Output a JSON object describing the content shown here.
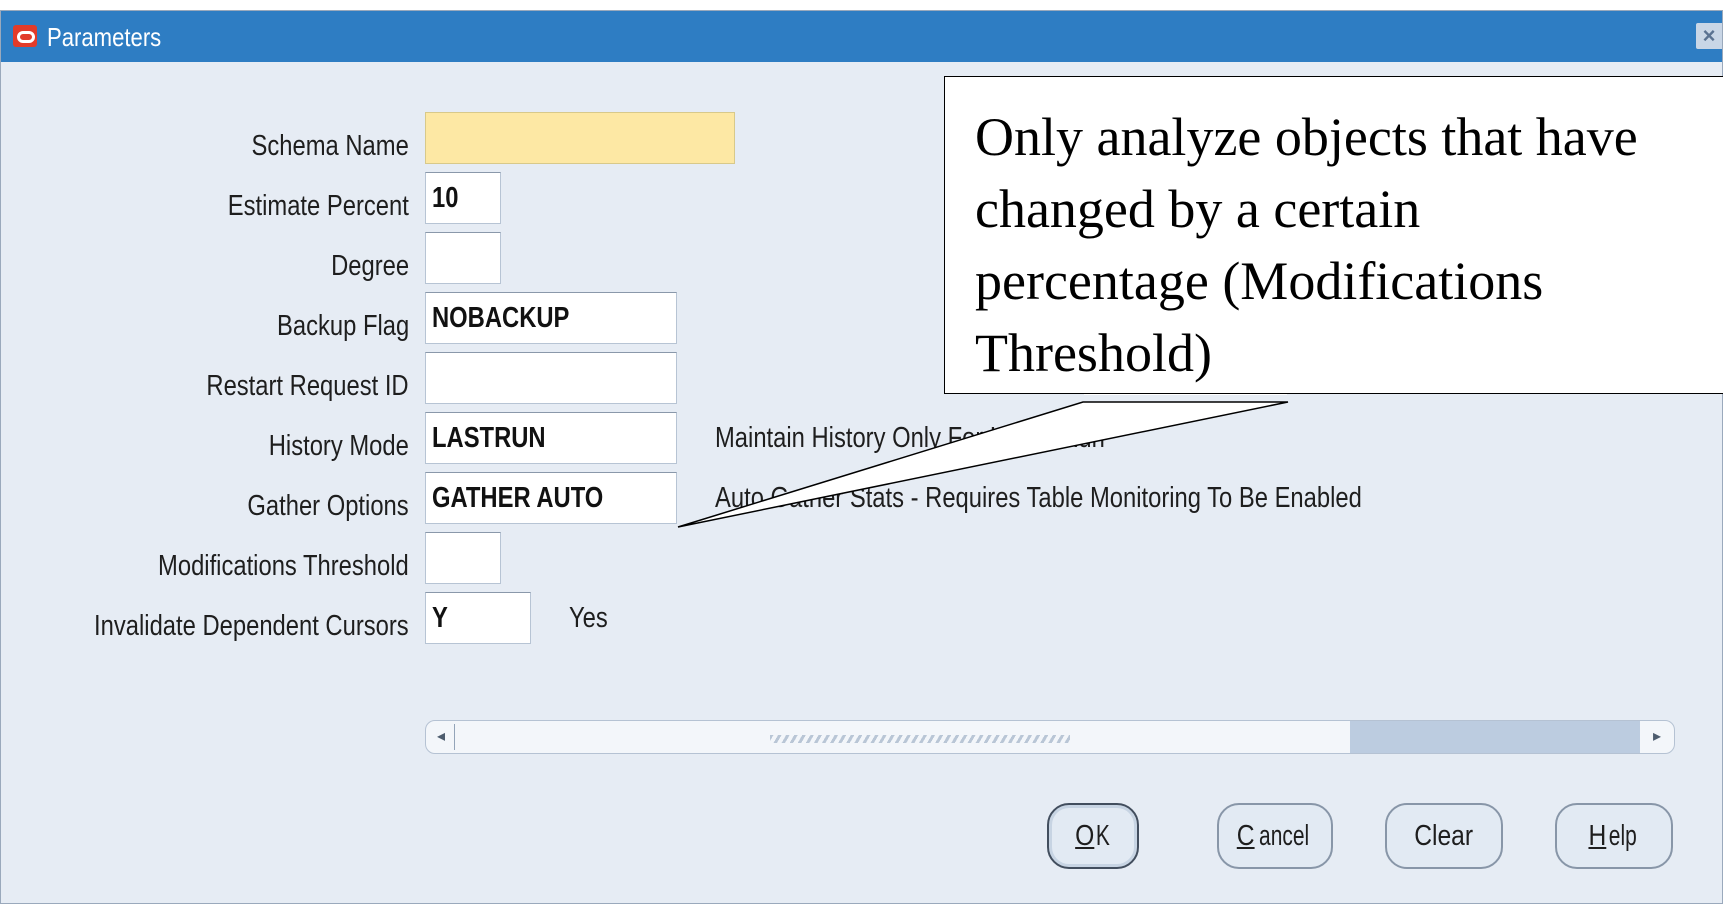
{
  "window": {
    "title": "Parameters",
    "close_glyph": "×",
    "title_icon": "oracle-logo-icon"
  },
  "form": {
    "fields": [
      {
        "label": "Schema Name",
        "value": "",
        "required": true
      },
      {
        "label": "Estimate Percent",
        "value": "10"
      },
      {
        "label": "Degree",
        "value": ""
      },
      {
        "label": "Backup Flag",
        "value": "NOBACKUP"
      },
      {
        "label": "Restart Request ID",
        "value": ""
      },
      {
        "label": "History Mode",
        "value": "LASTRUN",
        "description": "Maintain History Only For Latest Run"
      },
      {
        "label": "Gather Options",
        "value": "GATHER AUTO",
        "description": "Auto Gather Stats - Requires Table Monitoring To Be Enabled"
      },
      {
        "label": "Modifications Threshold",
        "value": ""
      },
      {
        "label": "Invalidate Dependent Cursors",
        "value": "Y",
        "description": "Yes"
      }
    ]
  },
  "scrollbar": {
    "left_arrow": "◂",
    "right_arrow": "▸"
  },
  "buttons": {
    "ok": {
      "mnemonic": "O",
      "rest": "K"
    },
    "cancel": {
      "mnemonic": "C",
      "rest": "ancel"
    },
    "clear": {
      "label": "Clear"
    },
    "help": {
      "mnemonic": "H",
      "rest": "elp"
    }
  },
  "callout": {
    "lines": [
      "Only analyze objects that have",
      "changed by a certain",
      "percentage (Modifications",
      "Threshold)"
    ]
  },
  "colors": {
    "title_bar": "#2e7dc3",
    "dialog_bg": "#e6ecf4",
    "required_field": "#fde8a4"
  }
}
